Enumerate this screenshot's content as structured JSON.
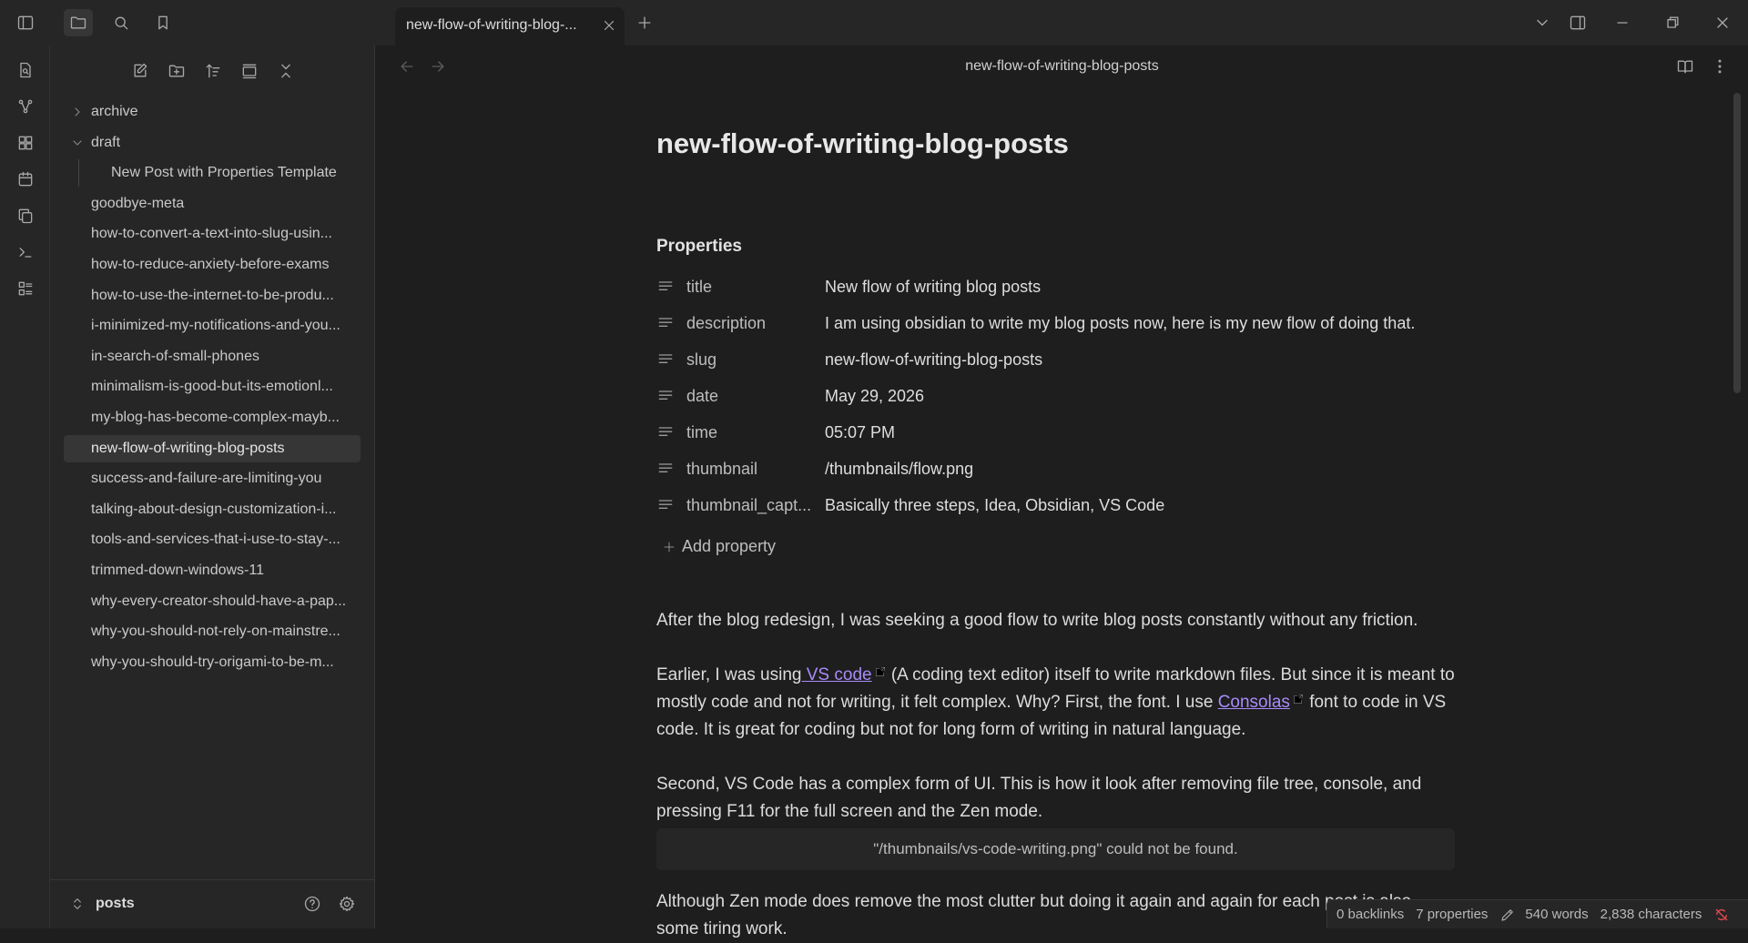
{
  "tab": {
    "label": "new-flow-of-writing-blog-..."
  },
  "sidebar": {
    "tree": [
      {
        "type": "folder",
        "label": "archive",
        "expanded": false
      },
      {
        "type": "folder",
        "label": "draft",
        "expanded": true
      },
      {
        "type": "child",
        "label": "New Post with Properties Template"
      },
      {
        "type": "file",
        "label": "goodbye-meta"
      },
      {
        "type": "file",
        "label": "how-to-convert-a-text-into-slug-usin..."
      },
      {
        "type": "file",
        "label": "how-to-reduce-anxiety-before-exams"
      },
      {
        "type": "file",
        "label": "how-to-use-the-internet-to-be-produ..."
      },
      {
        "type": "file",
        "label": "i-minimized-my-notifications-and-you..."
      },
      {
        "type": "file",
        "label": "in-search-of-small-phones"
      },
      {
        "type": "file",
        "label": "minimalism-is-good-but-its-emotionl..."
      },
      {
        "type": "file",
        "label": "my-blog-has-become-complex-mayb..."
      },
      {
        "type": "file",
        "label": "new-flow-of-writing-blog-posts",
        "active": true
      },
      {
        "type": "file",
        "label": "success-and-failure-are-limiting-you"
      },
      {
        "type": "file",
        "label": "talking-about-design-customization-i..."
      },
      {
        "type": "file",
        "label": "tools-and-services-that-i-use-to-stay-..."
      },
      {
        "type": "file",
        "label": "trimmed-down-windows-11"
      },
      {
        "type": "file",
        "label": "why-every-creator-should-have-a-pap..."
      },
      {
        "type": "file",
        "label": "why-you-should-not-rely-on-mainstre..."
      },
      {
        "type": "file",
        "label": "why-you-should-try-origami-to-be-m..."
      }
    ],
    "vault_name": "posts"
  },
  "view": {
    "title": "new-flow-of-writing-blog-posts"
  },
  "doc": {
    "title": "new-flow-of-writing-blog-posts",
    "properties_heading": "Properties",
    "properties": [
      {
        "key": "title",
        "value": " New flow of writing blog posts"
      },
      {
        "key": "description",
        "value": "I am using obsidian to write my blog posts now, here is my new flow of doing that."
      },
      {
        "key": "slug",
        "value": "new-flow-of-writing-blog-posts"
      },
      {
        "key": "date",
        "value": "May 29, 2026"
      },
      {
        "key": "time",
        "value": "05:07 PM"
      },
      {
        "key": "thumbnail",
        "value": "/thumbnails/flow.png"
      },
      {
        "key": "thumbnail_capt...",
        "value": "Basically three steps, Idea, Obsidian, VS Code"
      }
    ],
    "add_property": "Add property",
    "p1": "After the blog redesign, I was seeking a good flow to write blog posts constantly without any friction.",
    "p2_before": "Earlier, I was using",
    "p2_link1": " VS code",
    "p2_mid": " (A coding text editor) itself to write markdown files. But since it is meant to mostly code and not for writing, it felt complex. Why? First, the font. I use ",
    "p2_link2": "Consolas",
    "p2_after": " font to code in VS code. It is great for coding but not for long form of writing in natural language.",
    "p3": "Second, VS Code has a complex form of UI. This is how it look after removing file tree, console, and pressing F11 for the full screen and the Zen mode.",
    "embed_missing": "\"/thumbnails/vs-code-writing.png\" could not be found.",
    "p4": "Although Zen mode does remove the most clutter but doing it again and again for each post is also some tiring work."
  },
  "status": {
    "backlinks": "0 backlinks",
    "properties": "7 properties",
    "words": "540 words",
    "characters": "2,838 characters"
  }
}
